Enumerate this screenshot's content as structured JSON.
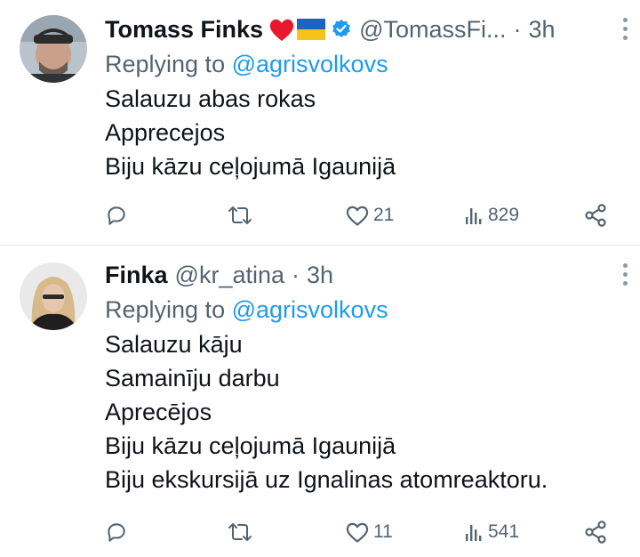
{
  "tweets": [
    {
      "author_name": "Tomass Finks",
      "emoji": [
        "heart",
        "ukraine-flag"
      ],
      "verified": true,
      "handle": "@TomassFi...",
      "dot": "·",
      "time": "3h",
      "replying_prefix": "Replying to",
      "replying_handle": "@agrisvolkovs",
      "lines": [
        "Salauzu abas rokas",
        "Apprecejos",
        "Biju kāzu ceļojumā Igaunijā"
      ],
      "likes": "21",
      "views": "829"
    },
    {
      "author_name": "Finka",
      "handle": "@kr_atina",
      "dot": "·",
      "time": "3h",
      "replying_prefix": "Replying to",
      "replying_handle": "@agrisvolkovs",
      "lines": [
        "Salauzu kāju",
        "Samainīju darbu",
        "Aprecējos",
        "Biju kāzu ceļojumā Igaunijā",
        "Biju ekskursijā uz Ignalinas atomreaktoru."
      ],
      "likes": "11",
      "views": "541"
    }
  ],
  "colors": {
    "accent": "#1d9bf0",
    "muted": "#536471",
    "text": "#0f1419"
  }
}
